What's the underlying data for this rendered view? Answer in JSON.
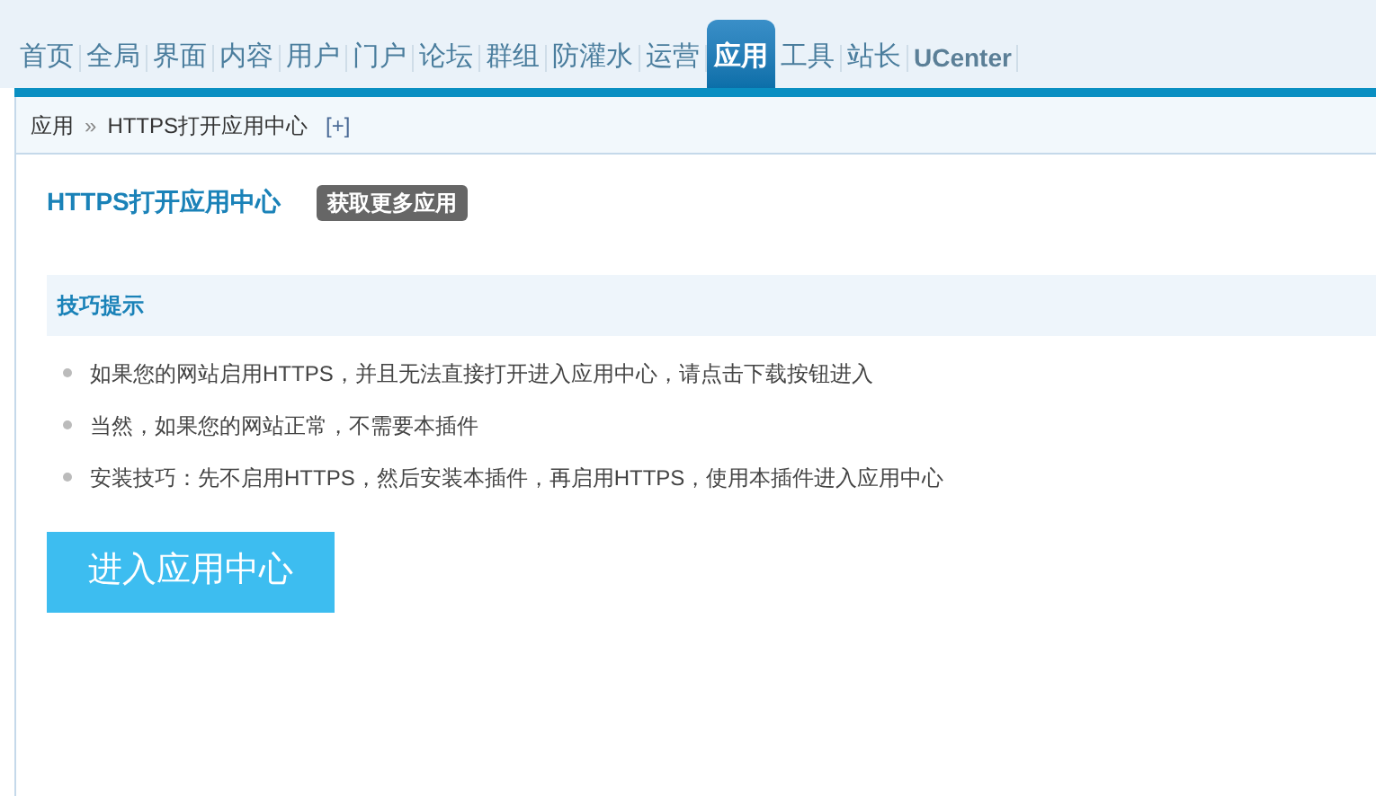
{
  "nav": [
    {
      "label": "首页",
      "selected": false
    },
    {
      "label": "全局",
      "selected": false
    },
    {
      "label": "界面",
      "selected": false
    },
    {
      "label": "内容",
      "selected": false
    },
    {
      "label": "用户",
      "selected": false
    },
    {
      "label": "门户",
      "selected": false
    },
    {
      "label": "论坛",
      "selected": false
    },
    {
      "label": "群组",
      "selected": false
    },
    {
      "label": "防灌水",
      "selected": false
    },
    {
      "label": "运营",
      "selected": false
    },
    {
      "label": "应用",
      "selected": true
    },
    {
      "label": "工具",
      "selected": false
    },
    {
      "label": "站长",
      "selected": false
    },
    {
      "label": "UCenter",
      "selected": false
    }
  ],
  "breadcrumb": {
    "root": "应用",
    "separator": "»",
    "current": "HTTPS打开应用中心",
    "add": "[+]"
  },
  "header": {
    "title": "HTTPS打开应用中心",
    "badge": "获取更多应用"
  },
  "tips": {
    "title": "技巧提示",
    "items": [
      "如果您的网站启用HTTPS，并且无法直接打开进入应用中心，请点击下载按钮进入",
      "当然，如果您的网站正常，不需要本插件",
      "安装技巧：先不启用HTTPS，然后安装本插件，再启用HTTPS，使用本插件进入应用中心"
    ]
  },
  "button": {
    "label": "进入应用中心"
  }
}
